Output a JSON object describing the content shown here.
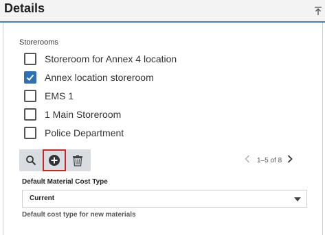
{
  "header": {
    "title": "Details"
  },
  "storerooms": {
    "label": "Storerooms",
    "items": [
      {
        "label": "Storeroom for Annex 4 location",
        "checked": false
      },
      {
        "label": "Annex location storeroom",
        "checked": true
      },
      {
        "label": "EMS 1",
        "checked": false
      },
      {
        "label": "1 Main Storeroom",
        "checked": false
      },
      {
        "label": "Police Department",
        "checked": false
      }
    ]
  },
  "toolbar": {
    "buttons": [
      {
        "icon": "search-icon"
      },
      {
        "icon": "add-circle-icon",
        "selected": true
      },
      {
        "icon": "trash-icon"
      }
    ]
  },
  "pager": {
    "text": "1–5 of 8"
  },
  "cost_type": {
    "label": "Default Material Cost Type",
    "value": "Current",
    "help": "Default cost type for new materials"
  },
  "colors": {
    "accent": "#2f6fb3",
    "header_rule": "#4a7fb5",
    "selected_outline": "#c8262b",
    "toolbar_bg": "#d9dde2"
  }
}
